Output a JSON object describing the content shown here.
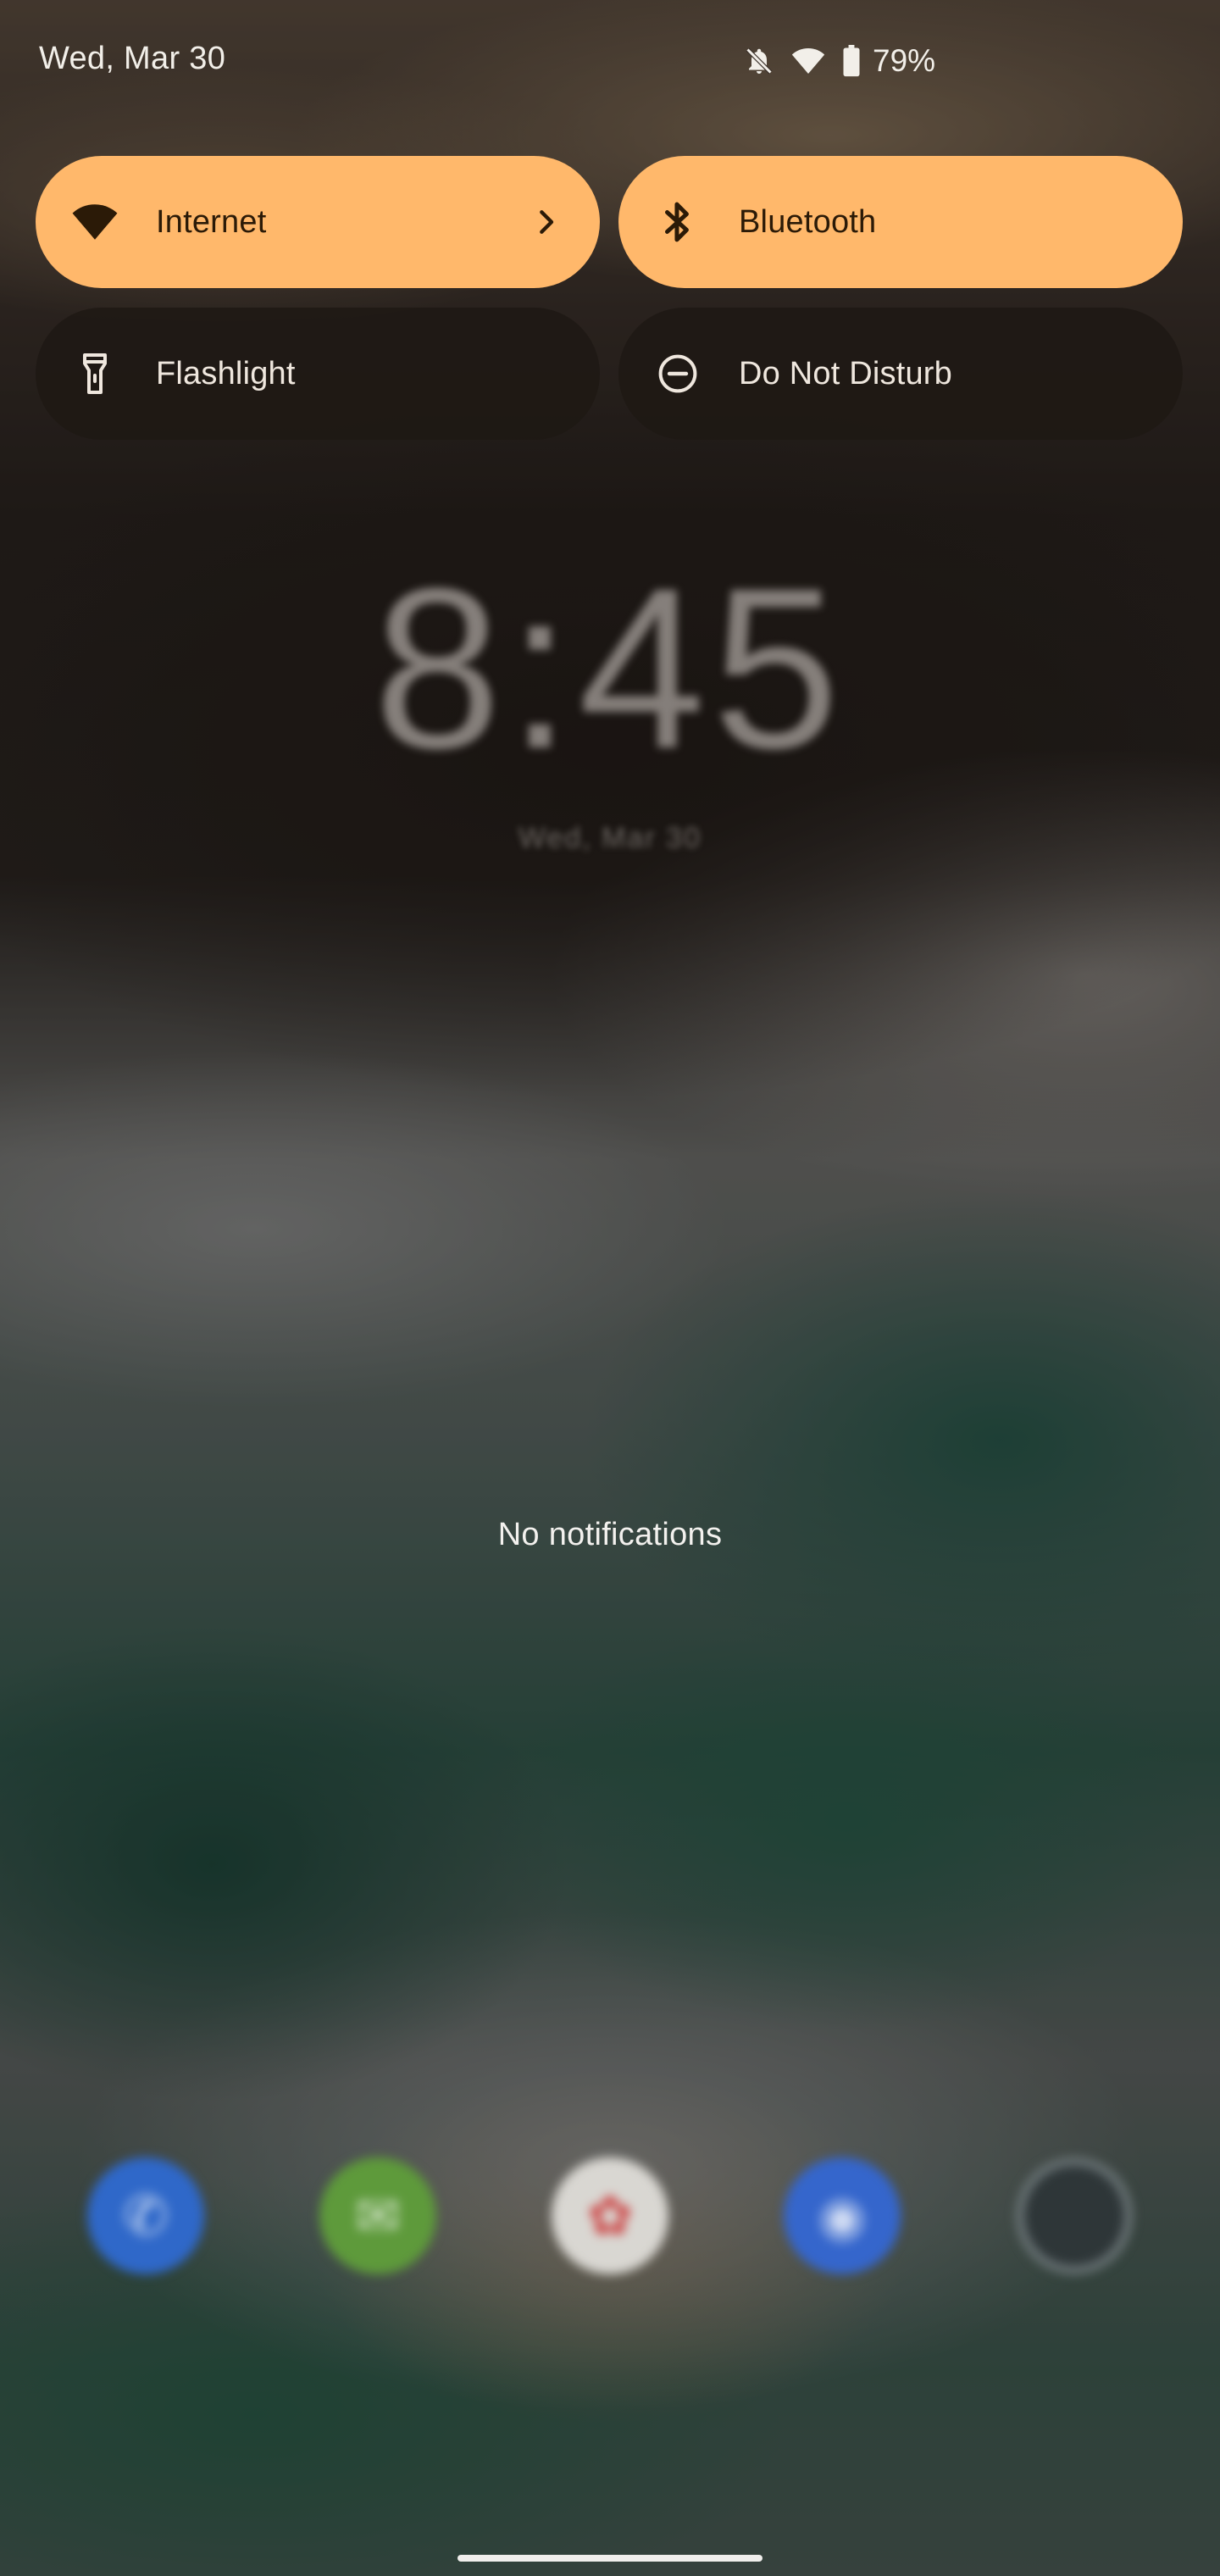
{
  "status_bar": {
    "date": "Wed, Mar 30",
    "battery_percent": "79%",
    "icons": [
      "notifications-off-icon",
      "wifi-icon",
      "battery-icon"
    ]
  },
  "quick_settings": {
    "tiles": [
      {
        "label": "Internet",
        "icon": "wifi-icon",
        "state": "on",
        "has_chevron": true
      },
      {
        "label": "Bluetooth",
        "icon": "bluetooth-icon",
        "state": "on"
      },
      {
        "label": "Flashlight",
        "icon": "flashlight-icon",
        "state": "off"
      },
      {
        "label": "Do Not Disturb",
        "icon": "do-not-disturb-icon",
        "state": "off"
      }
    ],
    "colors": {
      "active_tile": "#ffb86b",
      "inactive_tile": "#1e1814"
    }
  },
  "lockscreen": {
    "clock": "8:45",
    "date": "Wed, Mar 30"
  },
  "notifications": {
    "empty_text": "No notifications"
  },
  "dock": {
    "icons": [
      "phone-app-icon",
      "messages-app-icon",
      "photos-app-icon",
      "chrome-app-icon",
      "camera-app-icon"
    ]
  }
}
